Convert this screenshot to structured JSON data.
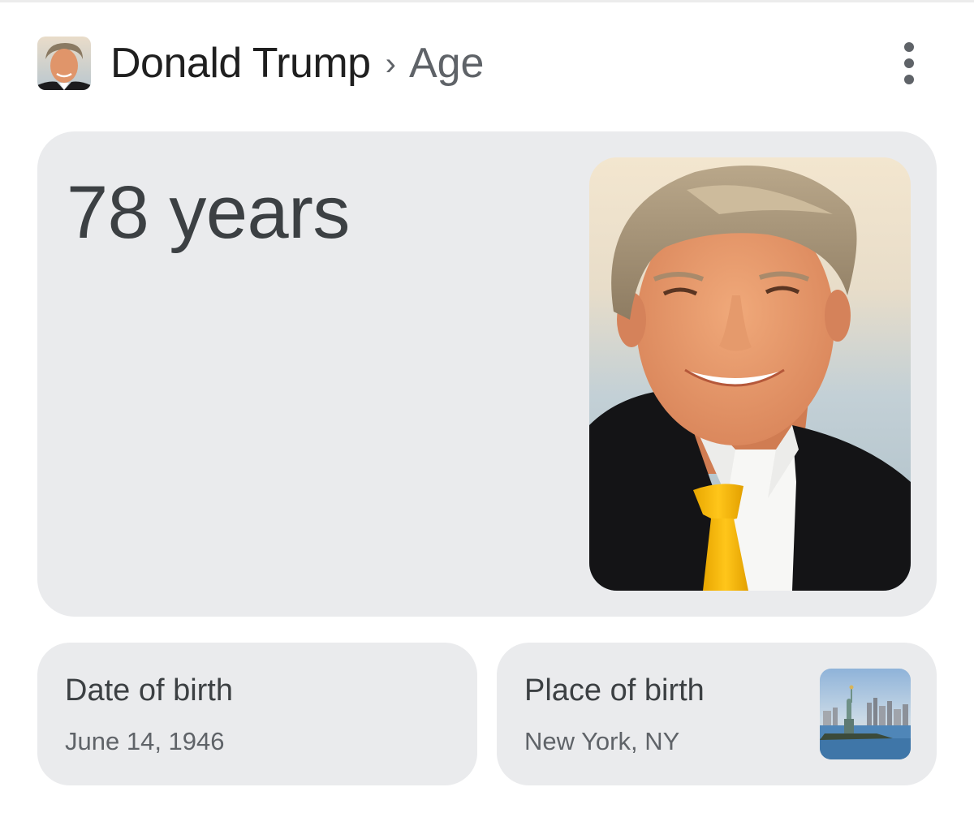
{
  "header": {
    "entity": "Donald Trump",
    "separator": "›",
    "attribute": "Age",
    "avatar_icon": "person-portrait-thumbnail",
    "menu_icon": "more-vert-icon"
  },
  "answer": {
    "text": "78 years",
    "image_icon": "person-portrait-photo"
  },
  "facts": [
    {
      "label": "Date of birth",
      "value": "June 14, 1946"
    },
    {
      "label": "Place of birth",
      "value": "New York, NY",
      "image_icon": "statue-of-liberty-thumbnail"
    }
  ],
  "colors": {
    "card_bg": "#eaebed",
    "primary_text": "#1f1f1f",
    "secondary_text": "#5f6368",
    "tie": "#f2b600"
  }
}
